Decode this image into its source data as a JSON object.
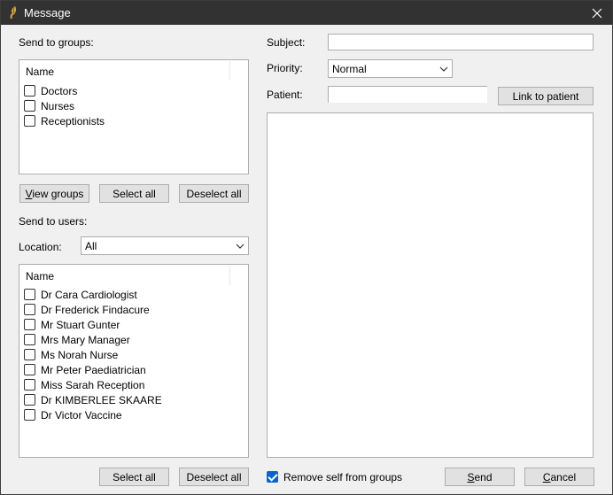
{
  "window": {
    "title": "Message"
  },
  "groups": {
    "label": "Send to groups:",
    "column_header": "Name",
    "items": [
      {
        "label": "Doctors",
        "checked": false
      },
      {
        "label": "Nurses",
        "checked": false
      },
      {
        "label": "Receptionists",
        "checked": false
      }
    ],
    "buttons": {
      "view": "View groups",
      "select_all": "Select all",
      "deselect_all": "Deselect all"
    }
  },
  "users": {
    "label": "Send to users:",
    "location_label": "Location:",
    "location_value": "All",
    "column_header": "Name",
    "items": [
      {
        "label": "Dr Cara Cardiologist",
        "checked": false
      },
      {
        "label": "Dr Frederick Findacure",
        "checked": false
      },
      {
        "label": "Mr Stuart Gunter",
        "checked": false
      },
      {
        "label": "Mrs Mary Manager",
        "checked": false
      },
      {
        "label": "Ms Norah Nurse",
        "checked": false
      },
      {
        "label": "Mr Peter Paediatrician",
        "checked": false
      },
      {
        "label": "Miss Sarah Reception",
        "checked": false
      },
      {
        "label": "Dr KIMBERLEE SKAARE",
        "checked": false
      },
      {
        "label": "Dr Victor Vaccine",
        "checked": false
      }
    ],
    "buttons": {
      "select_all": "Select all",
      "deselect_all": "Deselect all"
    }
  },
  "form": {
    "subject_label": "Subject:",
    "subject_value": "",
    "priority_label": "Priority:",
    "priority_value": "Normal",
    "patient_label": "Patient:",
    "patient_value": "",
    "link_button": "Link to patient",
    "body_value": ""
  },
  "footer": {
    "remove_self_label": "Remove self from groups",
    "remove_self_checked": true,
    "send": "Send",
    "cancel": "Cancel"
  },
  "colors": {
    "titlebar": "#323232",
    "accent": "#0a64c8",
    "button_face": "#e1e1e1",
    "border": "#adadad"
  }
}
